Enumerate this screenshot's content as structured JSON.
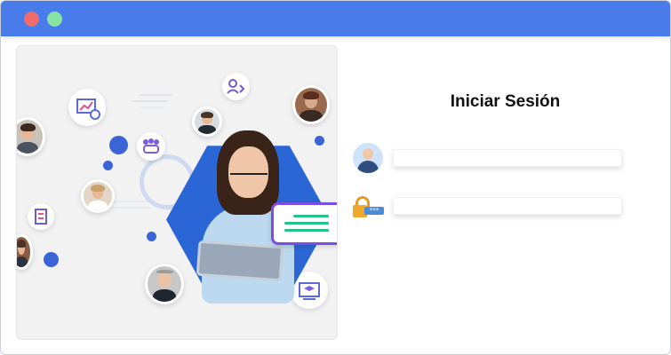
{
  "window": {
    "controls": [
      "close",
      "maximize"
    ],
    "titlebar_color": "#4a7bea"
  },
  "login": {
    "title": "Iniciar Sesión",
    "username_value": "",
    "password_value": ""
  },
  "icons": {
    "user": "user-avatar-icon",
    "password": "lock-password-icon"
  },
  "illustration": {
    "accent_color": "#2a66d6",
    "card_border_color": "#7c4ee0",
    "card_line_color": "#22c28a"
  }
}
